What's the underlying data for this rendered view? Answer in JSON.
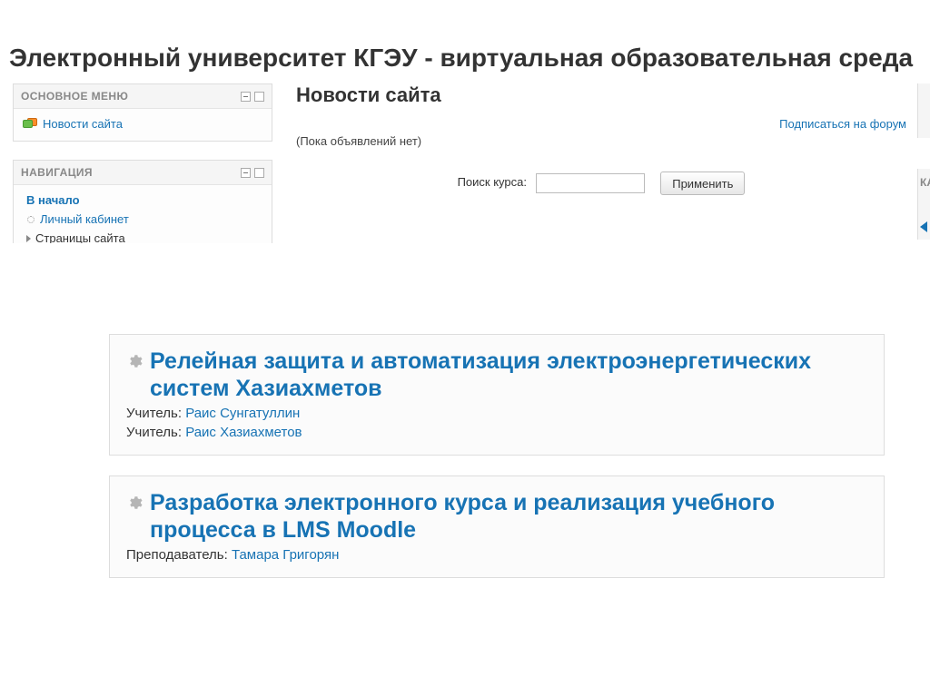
{
  "page_title": "Электронный университет КГЭУ - виртуальная образовательная среда",
  "main_menu": {
    "header": "ОСНОВНОЕ МЕНЮ",
    "item1": "Новости сайта"
  },
  "navigation": {
    "header": "НАВИГАЦИЯ",
    "home": "В начало",
    "personal": "Личный кабинет",
    "site_pages": "Страницы сайта"
  },
  "center": {
    "news_heading": "Новости сайта",
    "subscribe": "Подписаться на форум",
    "no_announcements": "(Пока объявлений нет)",
    "search_label": "Поиск курса:",
    "apply": "Применить"
  },
  "right": {
    "calendar_label": "КАЛ"
  },
  "courses": [
    {
      "title": "Релейная защита и автоматизация электроэнергетических систем Хазиахметов",
      "teacher_role": "Учитель:",
      "teachers": [
        "Раис Сунгатуллин",
        "Раис Хазиахметов"
      ]
    },
    {
      "title": "Разработка электронного курса и реализация учебного процесса в LMS Moodle",
      "teacher_role": "Преподаватель:",
      "teachers": [
        "Тамара Григорян"
      ]
    }
  ]
}
